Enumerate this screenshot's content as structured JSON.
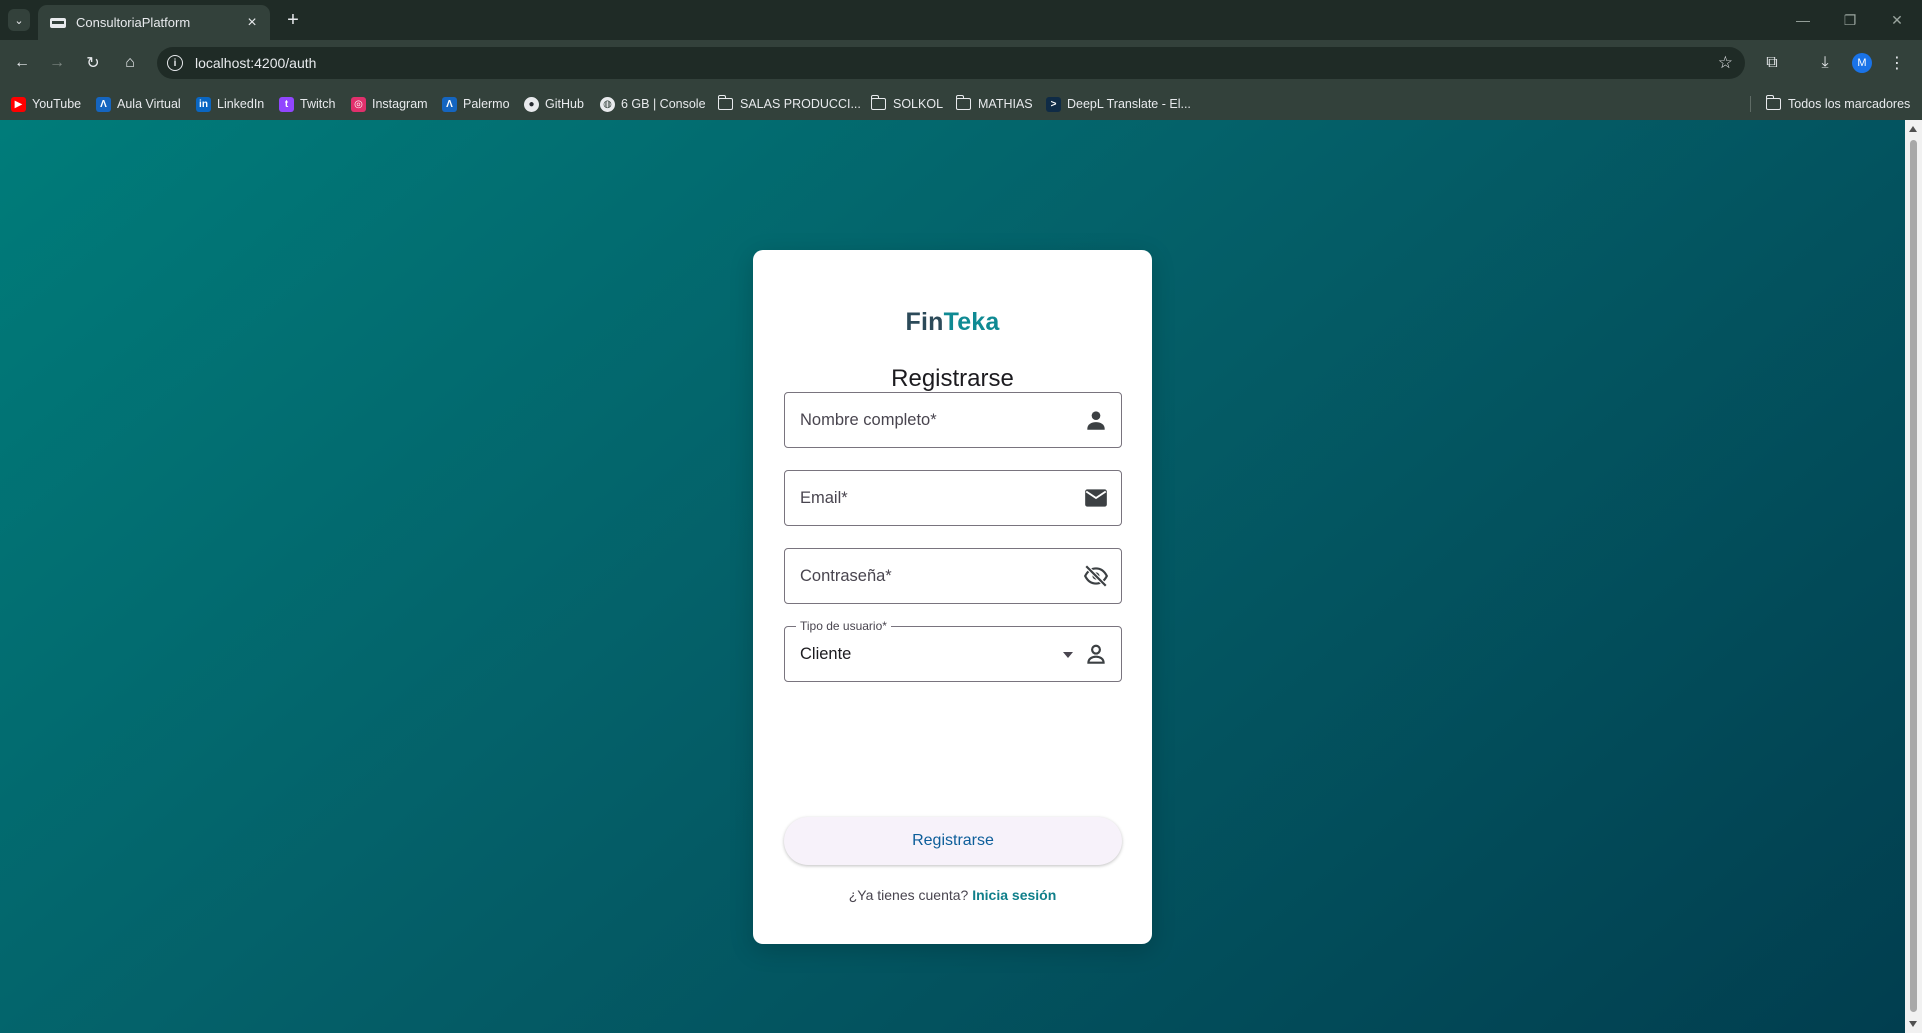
{
  "browser": {
    "tab_title": "ConsultoriaPlatform",
    "url": "localhost:4200/auth",
    "profile_initial": "M",
    "bookmarks": [
      {
        "label": "YouTube",
        "icon": "youtube-icon"
      },
      {
        "label": "Aula Virtual",
        "icon": "aula-virtual-icon"
      },
      {
        "label": "LinkedIn",
        "icon": "linkedin-icon"
      },
      {
        "label": "Twitch",
        "icon": "twitch-icon"
      },
      {
        "label": "Instagram",
        "icon": "instagram-icon"
      },
      {
        "label": "Palermo",
        "icon": "palermo-icon"
      },
      {
        "label": "GitHub",
        "icon": "github-icon"
      },
      {
        "label": "6 GB | Console",
        "icon": "globe-icon"
      },
      {
        "label": "SALAS PRODUCCI...",
        "icon": "folder-icon"
      },
      {
        "label": "SOLKOL",
        "icon": "folder-icon"
      },
      {
        "label": "MATHIAS",
        "icon": "folder-icon"
      },
      {
        "label": "DeepL Translate - El...",
        "icon": "deepl-icon"
      }
    ],
    "all_bookmarks_label": "Todos los marcadores"
  },
  "auth": {
    "logo_fin": "Fin",
    "logo_teka": "Teka",
    "title": "Registrarse",
    "fields": {
      "name_placeholder": "Nombre completo*",
      "email_placeholder": "Email*",
      "password_placeholder": "Contraseña*",
      "user_type_label": "Tipo de usuario*",
      "user_type_value": "Cliente"
    },
    "submit_label": "Registrarse",
    "switch_prompt": "¿Ya tienes cuenta?",
    "switch_link": "Inicia sesión"
  },
  "colors": {
    "gradient_start": "#007c7a",
    "gradient_end": "#013e4f",
    "brand_dark": "#2c4a59",
    "brand_teal": "#0f8a93",
    "button_text": "#0d5e9a"
  }
}
